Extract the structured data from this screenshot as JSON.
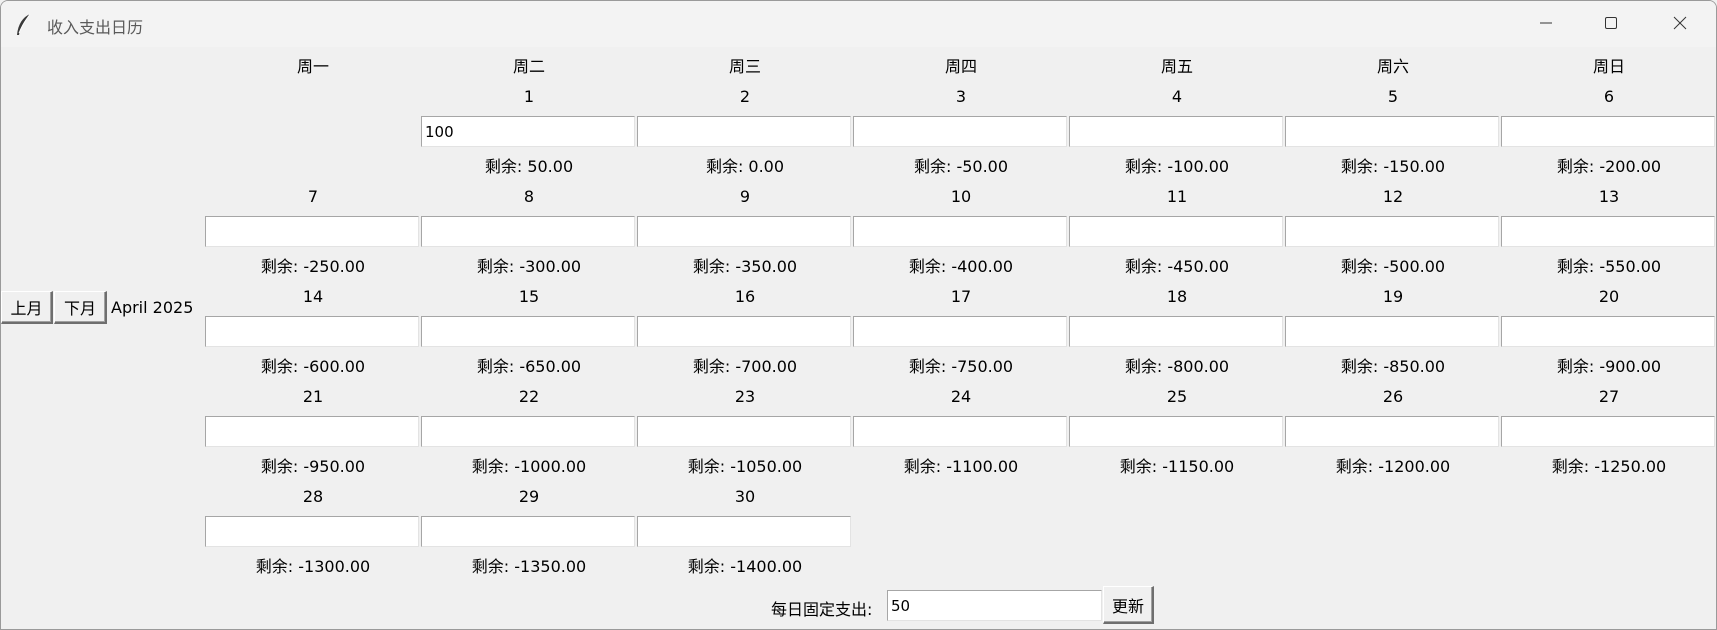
{
  "window": {
    "title": "收入支出日历",
    "icon": "feather-icon"
  },
  "nav": {
    "prev_label": "上月",
    "next_label": "下月",
    "month_label": "April 2025"
  },
  "weekdays": [
    "周一",
    "周二",
    "周三",
    "周四",
    "周五",
    "周六",
    "周日"
  ],
  "days": [
    {
      "day": "1",
      "entry": "100",
      "remaining": "剩余: 50.00"
    },
    {
      "day": "2",
      "entry": "",
      "remaining": "剩余: 0.00"
    },
    {
      "day": "3",
      "entry": "",
      "remaining": "剩余: -50.00"
    },
    {
      "day": "4",
      "entry": "",
      "remaining": "剩余: -100.00"
    },
    {
      "day": "5",
      "entry": "",
      "remaining": "剩余: -150.00"
    },
    {
      "day": "6",
      "entry": "",
      "remaining": "剩余: -200.00"
    },
    {
      "day": "7",
      "entry": "",
      "remaining": "剩余: -250.00"
    },
    {
      "day": "8",
      "entry": "",
      "remaining": "剩余: -300.00"
    },
    {
      "day": "9",
      "entry": "",
      "remaining": "剩余: -350.00"
    },
    {
      "day": "10",
      "entry": "",
      "remaining": "剩余: -400.00"
    },
    {
      "day": "11",
      "entry": "",
      "remaining": "剩余: -450.00"
    },
    {
      "day": "12",
      "entry": "",
      "remaining": "剩余: -500.00"
    },
    {
      "day": "13",
      "entry": "",
      "remaining": "剩余: -550.00"
    },
    {
      "day": "14",
      "entry": "",
      "remaining": "剩余: -600.00"
    },
    {
      "day": "15",
      "entry": "",
      "remaining": "剩余: -650.00"
    },
    {
      "day": "16",
      "entry": "",
      "remaining": "剩余: -700.00"
    },
    {
      "day": "17",
      "entry": "",
      "remaining": "剩余: -750.00"
    },
    {
      "day": "18",
      "entry": "",
      "remaining": "剩余: -800.00"
    },
    {
      "day": "19",
      "entry": "",
      "remaining": "剩余: -850.00"
    },
    {
      "day": "20",
      "entry": "",
      "remaining": "剩余: -900.00"
    },
    {
      "day": "21",
      "entry": "",
      "remaining": "剩余: -950.00"
    },
    {
      "day": "22",
      "entry": "",
      "remaining": "剩余: -1000.00"
    },
    {
      "day": "23",
      "entry": "",
      "remaining": "剩余: -1050.00"
    },
    {
      "day": "24",
      "entry": "",
      "remaining": "剩余: -1100.00"
    },
    {
      "day": "25",
      "entry": "",
      "remaining": "剩余: -1150.00"
    },
    {
      "day": "26",
      "entry": "",
      "remaining": "剩余: -1200.00"
    },
    {
      "day": "27",
      "entry": "",
      "remaining": "剩余: -1250.00"
    },
    {
      "day": "28",
      "entry": "",
      "remaining": "剩余: -1300.00"
    },
    {
      "day": "29",
      "entry": "",
      "remaining": "剩余: -1350.00"
    },
    {
      "day": "30",
      "entry": "",
      "remaining": "剩余: -1400.00"
    }
  ],
  "footer": {
    "fixed_expense_label": "每日固定支出:",
    "fixed_expense_value": "50",
    "update_label": "更新"
  }
}
